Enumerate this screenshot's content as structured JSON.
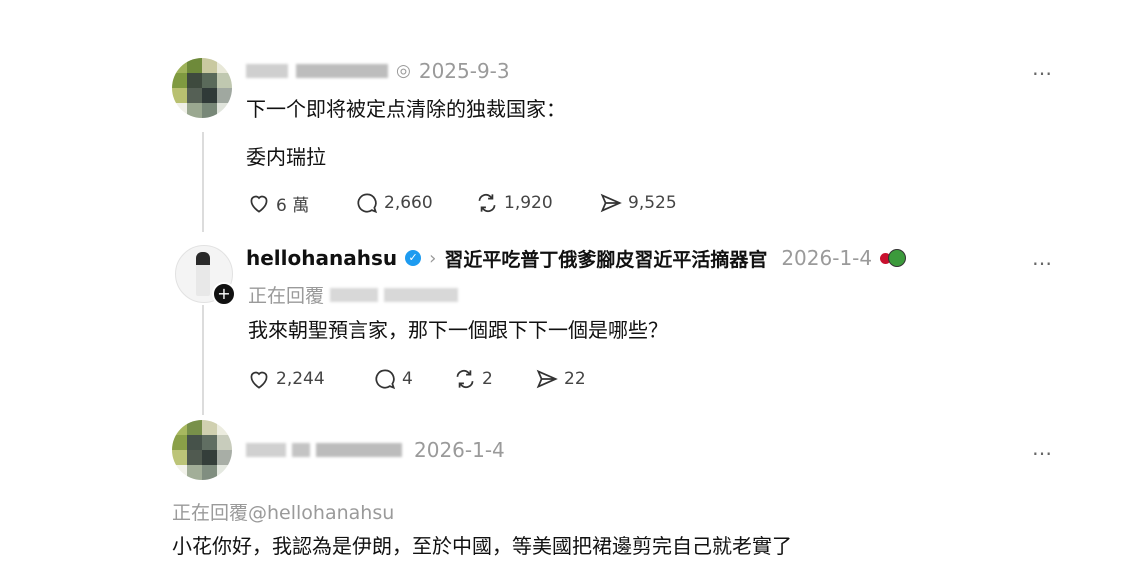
{
  "post1": {
    "date": "2025-9-3",
    "text_line1": "下一个即将被定点清除的独裁国家：",
    "text_line2": "委内瑞拉",
    "actions": {
      "likes": "6 萬",
      "replies": "2,660",
      "reposts": "1,920",
      "shares": "9,525"
    }
  },
  "reply1": {
    "username": "hellohanahsu",
    "bio": "習近平吃普丁俄爹腳皮習近平活摘器官",
    "date": "2026-1-4",
    "replying_prefix": "正在回覆",
    "text": "我來朝聖預言家，那下一個跟下下一個是哪些？",
    "actions": {
      "likes": "2,244",
      "replies": "4",
      "reposts": "2",
      "shares": "22"
    }
  },
  "post3": {
    "date": "2026-1-4",
    "replying_to": "正在回覆@hellohanahsu",
    "text": "小花你好，我認為是伊朗，至於中國，等美國把裙邊剪完自己就老實了"
  },
  "ui": {
    "more_label": "…"
  }
}
